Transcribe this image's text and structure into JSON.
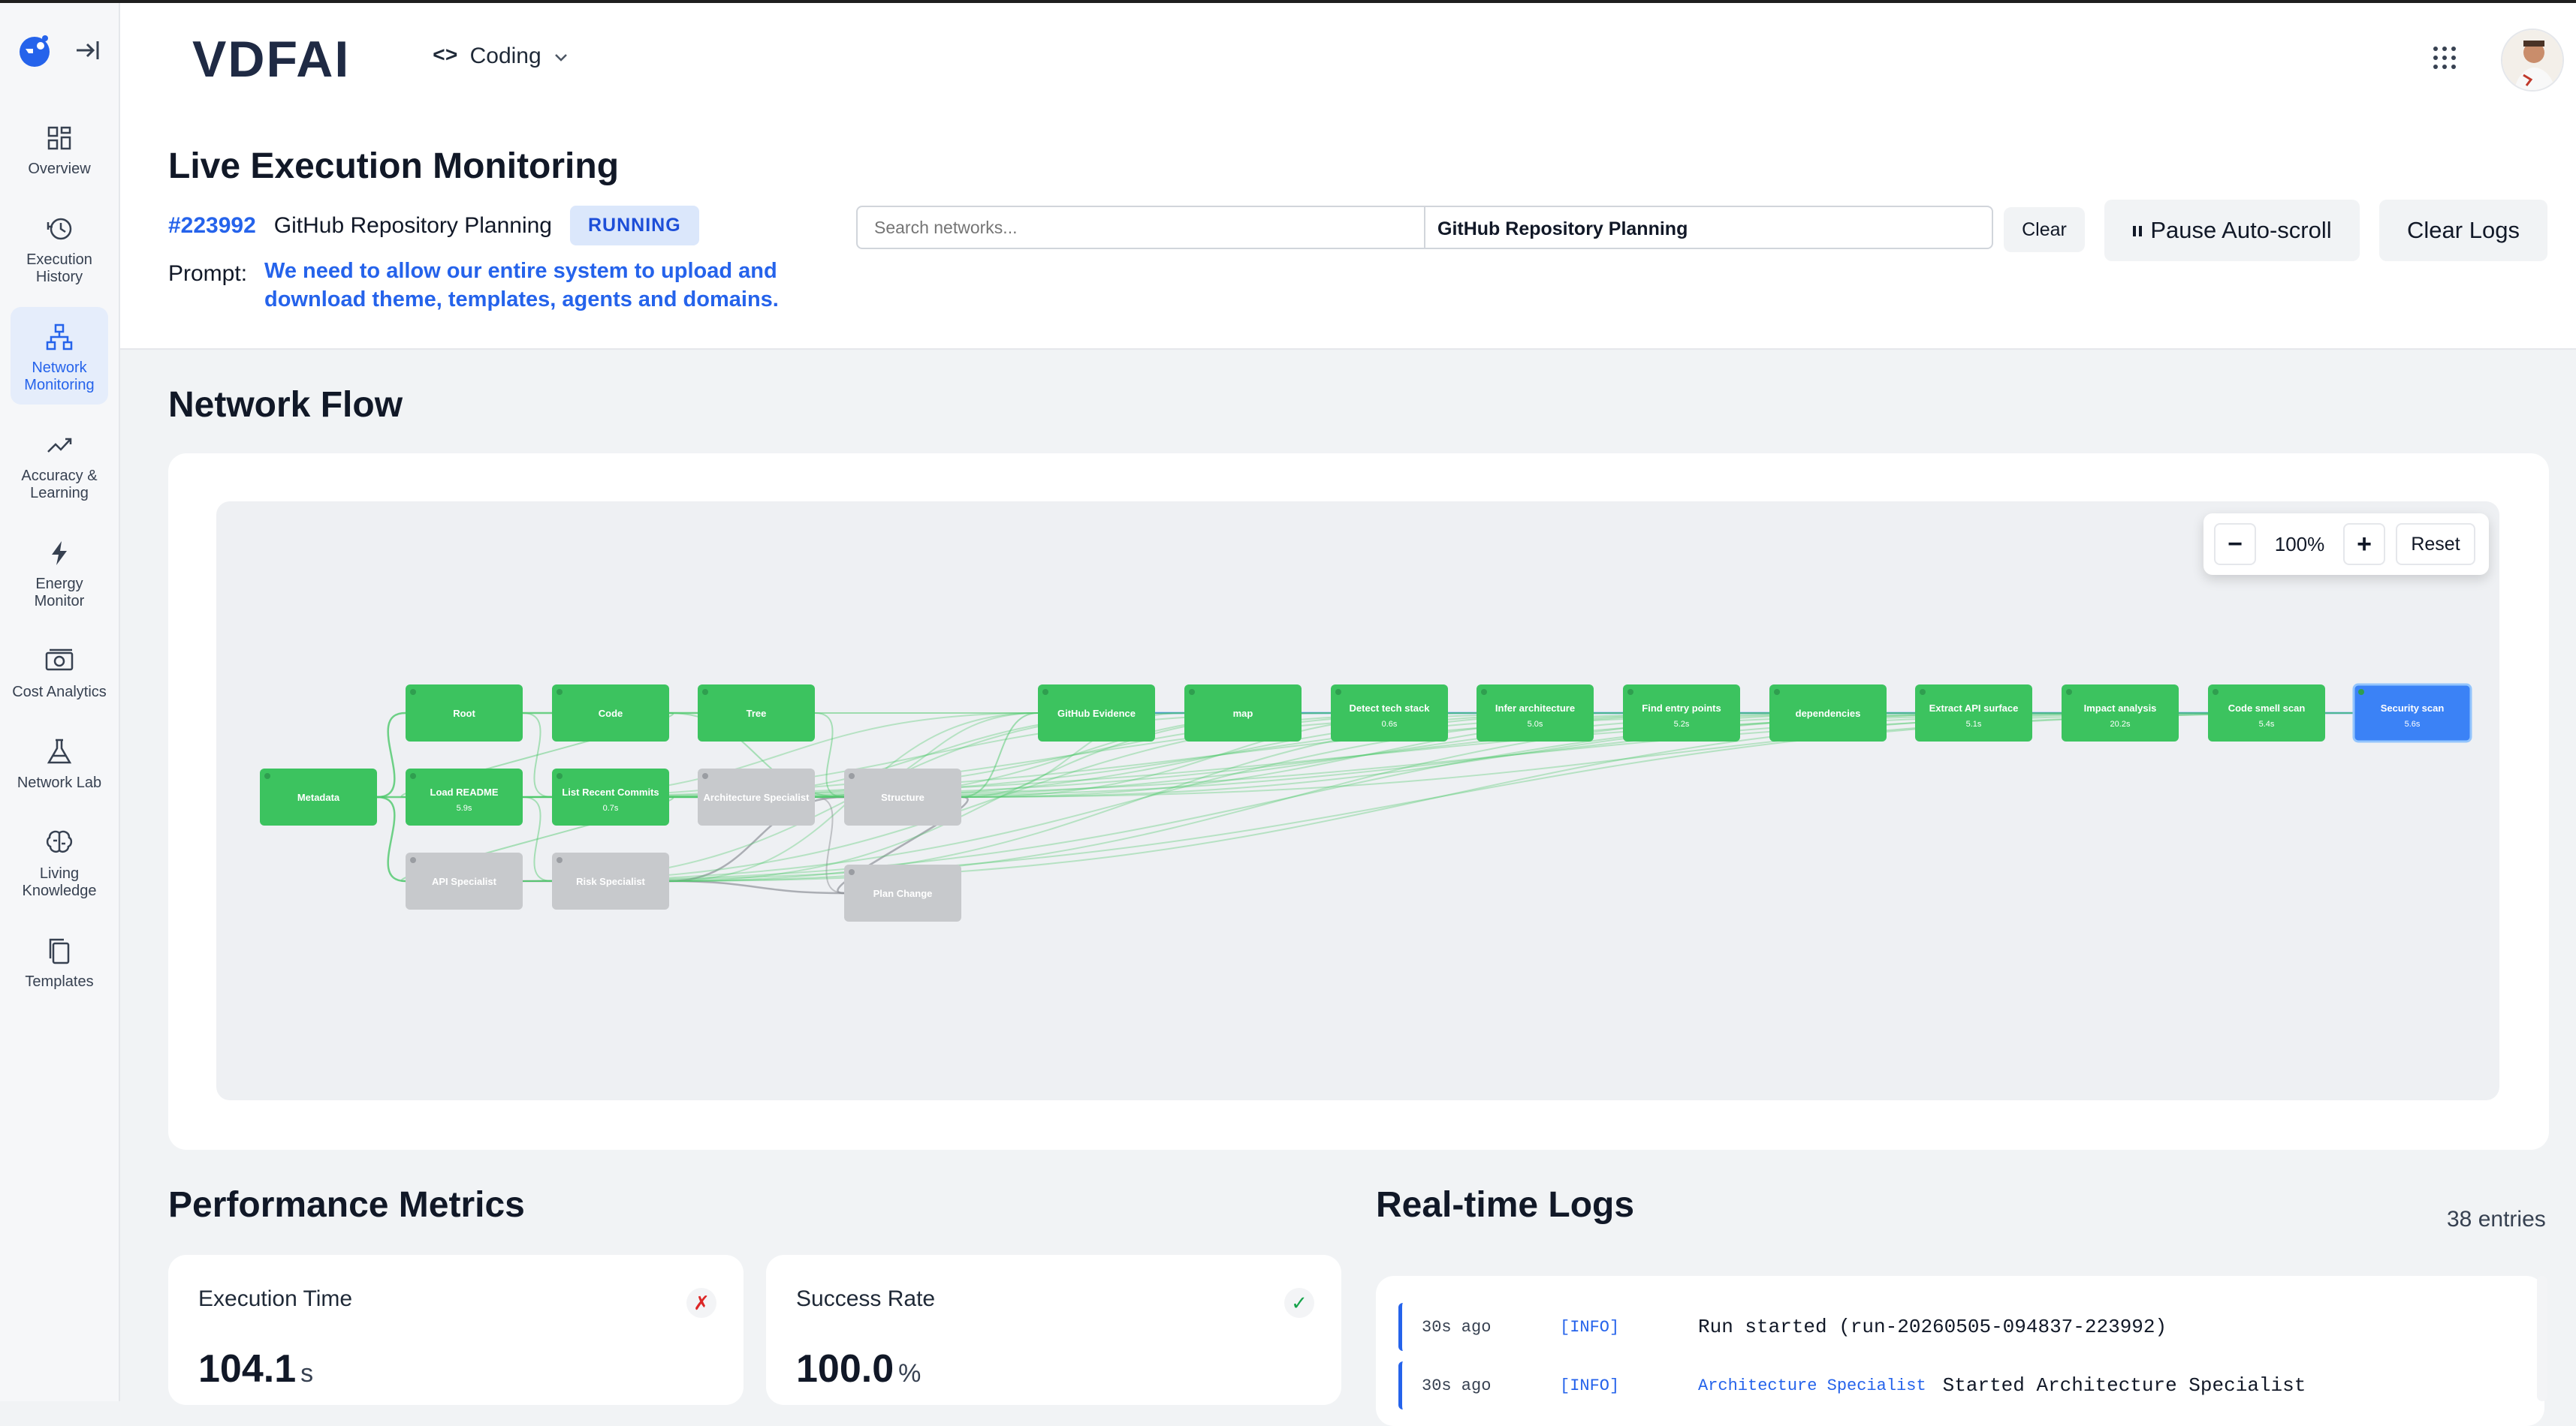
{
  "app": {
    "brand": "VDFAI",
    "workspace": "Coding"
  },
  "sidebar": {
    "items": [
      {
        "label": "Overview",
        "icon": "grid-icon"
      },
      {
        "label": "Execution History",
        "icon": "history-icon"
      },
      {
        "label": "Network Monitoring",
        "icon": "network-icon",
        "active": true
      },
      {
        "label": "Accuracy & Learning",
        "icon": "trend-icon"
      },
      {
        "label": "Energy Monitor",
        "icon": "bolt-icon"
      },
      {
        "label": "Cost Analytics",
        "icon": "money-icon"
      },
      {
        "label": "Network Lab",
        "icon": "flask-icon"
      },
      {
        "label": "Living Knowledge",
        "icon": "brain-icon"
      },
      {
        "label": "Templates",
        "icon": "copy-icon"
      }
    ]
  },
  "header": {
    "title": "Live Execution Monitoring",
    "run_id": "#223992",
    "run_name": "GitHub Repository Planning",
    "status": "RUNNING",
    "prompt_label": "Prompt:",
    "prompt_text": "We need to allow our entire system to upload and download theme, templates, agents and domains.",
    "search_placeholder": "Search networks...",
    "selected_network": "GitHub Repository Planning",
    "clear_label": "Clear",
    "pause_label": "Pause Auto-scroll",
    "clear_logs_label": "Clear Logs"
  },
  "flow": {
    "title": "Network Flow",
    "zoom_minus": "−",
    "zoom_value": "100%",
    "zoom_plus": "+",
    "zoom_reset": "Reset",
    "nodes": [
      {
        "id": "metadata",
        "label": "Metadata",
        "sub": "",
        "state": "done"
      },
      {
        "id": "root",
        "label": "Root",
        "sub": "",
        "state": "done"
      },
      {
        "id": "code",
        "label": "Code",
        "sub": "",
        "state": "done"
      },
      {
        "id": "tree",
        "label": "Tree",
        "sub": "",
        "state": "done"
      },
      {
        "id": "readme",
        "label": "Load README",
        "sub": "5.9s",
        "state": "done"
      },
      {
        "id": "commits",
        "label": "List Recent Commits",
        "sub": "0.7s",
        "state": "done"
      },
      {
        "id": "arch",
        "label": "Architecture Specialist",
        "sub": "",
        "state": "pending"
      },
      {
        "id": "structure",
        "label": "Structure",
        "sub": "",
        "state": "pending"
      },
      {
        "id": "api",
        "label": "API Specialist",
        "sub": "",
        "state": "pending"
      },
      {
        "id": "risk",
        "label": "Risk Specialist",
        "sub": "",
        "state": "pending"
      },
      {
        "id": "plan",
        "label": "Plan Change",
        "sub": "",
        "state": "pending"
      },
      {
        "id": "evidence",
        "label": "GitHub Evidence",
        "sub": "",
        "state": "done"
      },
      {
        "id": "map",
        "label": "map",
        "sub": "",
        "state": "done"
      },
      {
        "id": "tech",
        "label": "Detect tech stack",
        "sub": "0.6s",
        "state": "done"
      },
      {
        "id": "infer",
        "label": "Infer architecture",
        "sub": "5.0s",
        "state": "done"
      },
      {
        "id": "entry",
        "label": "Find entry points",
        "sub": "5.2s",
        "state": "done"
      },
      {
        "id": "deps",
        "label": "dependencies",
        "sub": "",
        "state": "done"
      },
      {
        "id": "apisurf",
        "label": "Extract API surface",
        "sub": "5.1s",
        "state": "done"
      },
      {
        "id": "impact",
        "label": "Impact analysis",
        "sub": "20.2s",
        "state": "done"
      },
      {
        "id": "smell",
        "label": "Code smell scan",
        "sub": "5.4s",
        "state": "done"
      },
      {
        "id": "security",
        "label": "Security scan",
        "sub": "5.6s",
        "state": "active"
      }
    ]
  },
  "metrics": {
    "title": "Performance Metrics",
    "items": [
      {
        "label": "Execution Time",
        "value": "104.1",
        "unit": "s",
        "status_icon": "✗"
      },
      {
        "label": "Success Rate",
        "value": "100.0",
        "unit": "%",
        "status_icon": "✓"
      }
    ]
  },
  "logs": {
    "title": "Real-time Logs",
    "count": "38 entries",
    "entries": [
      {
        "time": "30s ago",
        "level": "[INFO]",
        "source": "",
        "message": "Run started (run-20260505-094837-223992)"
      },
      {
        "time": "30s ago",
        "level": "[INFO]",
        "source": "Architecture Specialist",
        "message": "Started Architecture Specialist"
      }
    ]
  },
  "colors": {
    "accent": "#2563eb",
    "node_done": "#3cc35f",
    "node_pending": "#c7c9cc",
    "node_active": "#3b82f6"
  }
}
